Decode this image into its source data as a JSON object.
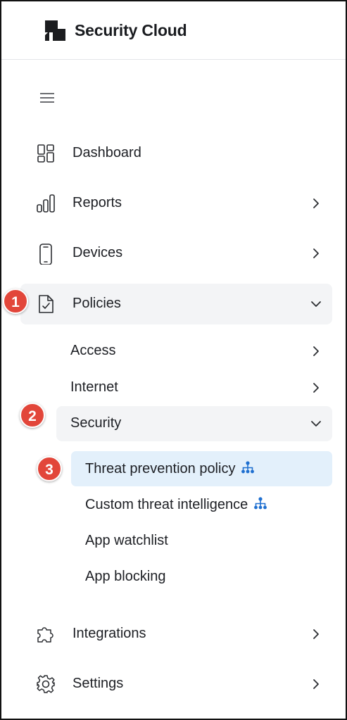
{
  "header": {
    "title": "Security Cloud",
    "logo_icon": "security-cloud-logo"
  },
  "menu_toggle": {
    "icon": "hamburger-menu-icon"
  },
  "nav": {
    "dashboard": {
      "label": "Dashboard",
      "icon": "dashboard-grid-icon"
    },
    "reports": {
      "label": "Reports",
      "icon": "bar-chart-icon"
    },
    "devices": {
      "label": "Devices",
      "icon": "mobile-device-icon"
    },
    "policies": {
      "label": "Policies",
      "icon": "document-check-icon",
      "expanded": true,
      "children": {
        "access": {
          "label": "Access"
        },
        "internet": {
          "label": "Internet"
        },
        "security": {
          "label": "Security",
          "expanded": true,
          "children": {
            "threat_prevention": {
              "label": "Threat prevention policy",
              "icon": "org-hierarchy-icon",
              "selected": true
            },
            "custom_threat": {
              "label": "Custom threat intelligence",
              "icon": "org-hierarchy-icon"
            },
            "app_watchlist": {
              "label": "App watchlist"
            },
            "app_blocking": {
              "label": "App blocking"
            }
          }
        }
      }
    },
    "integrations": {
      "label": "Integrations",
      "icon": "puzzle-piece-icon"
    },
    "settings": {
      "label": "Settings",
      "icon": "gear-icon"
    }
  },
  "callouts": {
    "step1": "1",
    "step2": "2",
    "step3": "3"
  },
  "colors": {
    "accent": "#1e6fd0",
    "selected_bg": "#e3f0fb",
    "hover_bg": "#f3f4f6",
    "badge": "#e2463a"
  }
}
